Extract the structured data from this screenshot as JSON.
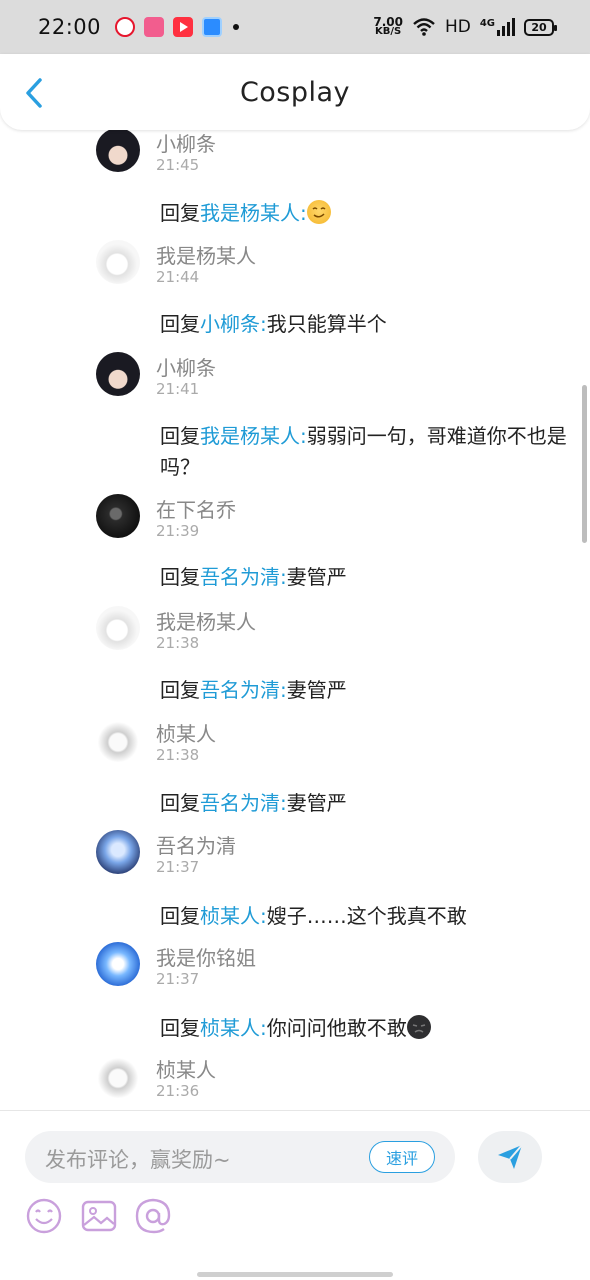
{
  "status_bar": {
    "time": "22:00",
    "net_speed_value": "7.00",
    "net_speed_unit": "KB/S",
    "hd": "HD",
    "signal": "4G",
    "battery": "20"
  },
  "header": {
    "title": "Cosplay"
  },
  "comments": [
    {
      "user": "小柳条",
      "time": "21:45",
      "reply_prefix": "回复",
      "reply_to": "我是杨某人:",
      "reply_text": "",
      "emoji": "smile"
    },
    {
      "user": "我是杨某人",
      "time": "21:44",
      "reply_prefix": "回复",
      "reply_to": "小柳条:",
      "reply_text": "我只能算半个",
      "emoji": ""
    },
    {
      "user": "小柳条",
      "time": "21:41",
      "reply_prefix": "回复",
      "reply_to": "我是杨某人:",
      "reply_text": "弱弱问一句，哥难道你不也是吗？",
      "emoji": ""
    },
    {
      "user": "在下名乔",
      "time": "21:39",
      "reply_prefix": "回复",
      "reply_to": "吾名为清:",
      "reply_text": "妻管严",
      "emoji": ""
    },
    {
      "user": "我是杨某人",
      "time": "21:38",
      "reply_prefix": "回复",
      "reply_to": "吾名为清:",
      "reply_text": "妻管严",
      "emoji": ""
    },
    {
      "user": "桢某人",
      "time": "21:38",
      "reply_prefix": "回复",
      "reply_to": "吾名为清:",
      "reply_text": "妻管严",
      "emoji": ""
    },
    {
      "user": "吾名为清",
      "time": "21:37",
      "reply_prefix": "回复",
      "reply_to": "桢某人:",
      "reply_text": "嫂子……这个我真不敢",
      "emoji": ""
    },
    {
      "user": "我是你铭姐",
      "time": "21:37",
      "reply_prefix": "回复",
      "reply_to": "桢某人:",
      "reply_text": "你问问他敢不敢",
      "emoji": "dark-face"
    },
    {
      "user": "桢某人",
      "time": "21:36",
      "reply_prefix": "",
      "reply_to": "",
      "reply_text": "",
      "emoji": ""
    }
  ],
  "composer": {
    "placeholder": "发布评论，赢奖励~",
    "quick_label": "速评"
  },
  "colors": {
    "accent": "#1f9bd6",
    "status_bar_bg": "#dcdcdc",
    "tool_icon": "#c9a0dc"
  },
  "icons": [
    "back-arrow-icon",
    "send-icon",
    "emoji-icon",
    "image-icon",
    "at-icon"
  ]
}
